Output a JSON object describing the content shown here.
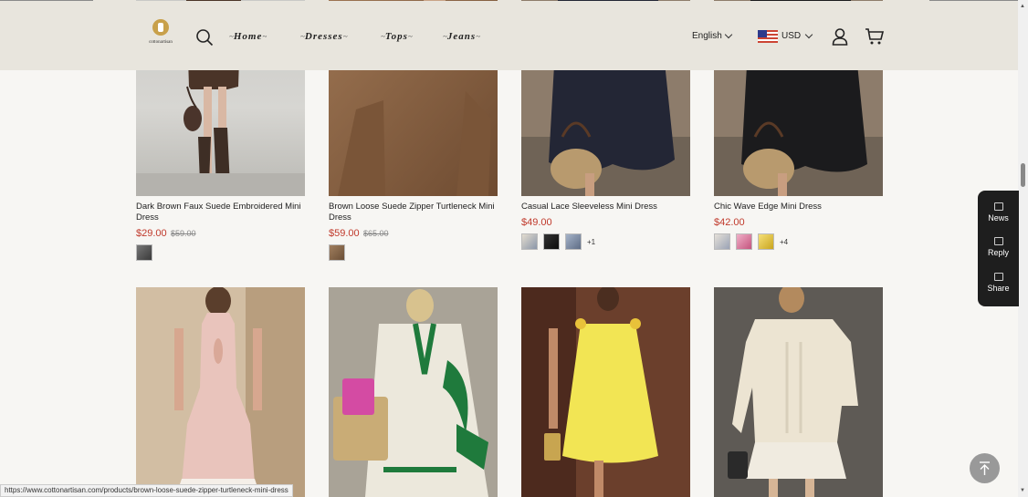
{
  "header": {
    "logo_text": "cottonartisan",
    "nav": [
      {
        "label": "Home"
      },
      {
        "label": "Dresses"
      },
      {
        "label": "Tops"
      },
      {
        "label": "Jeans"
      }
    ],
    "language": "English",
    "currency": "USD"
  },
  "products": [
    {
      "name": "Dark Brown Faux Suede Embroidered Mini Dress",
      "price": "$29.00",
      "compare_price": "$59.00"
    },
    {
      "name": "Brown Loose Suede Zipper Turtleneck Mini Dress",
      "price": "$59.00",
      "compare_price": "$65.00"
    },
    {
      "name": "Casual Lace Sleeveless Mini Dress",
      "price": "$49.00",
      "more_colors": "+1"
    },
    {
      "name": "Chic Wave Edge Mini Dress",
      "price": "$42.00",
      "more_colors": "+4"
    }
  ],
  "side_panel": {
    "news": "News",
    "reply": "Reply",
    "share": "Share"
  },
  "status_bar": {
    "url": "https://www.cottonartisan.com/products/brown-loose-suede-zipper-turtleneck-mini-dress"
  },
  "colors": {
    "header_bg": "#e8e5dd",
    "price_red": "#c0392b",
    "side_panel_bg": "#1e1e1e"
  }
}
